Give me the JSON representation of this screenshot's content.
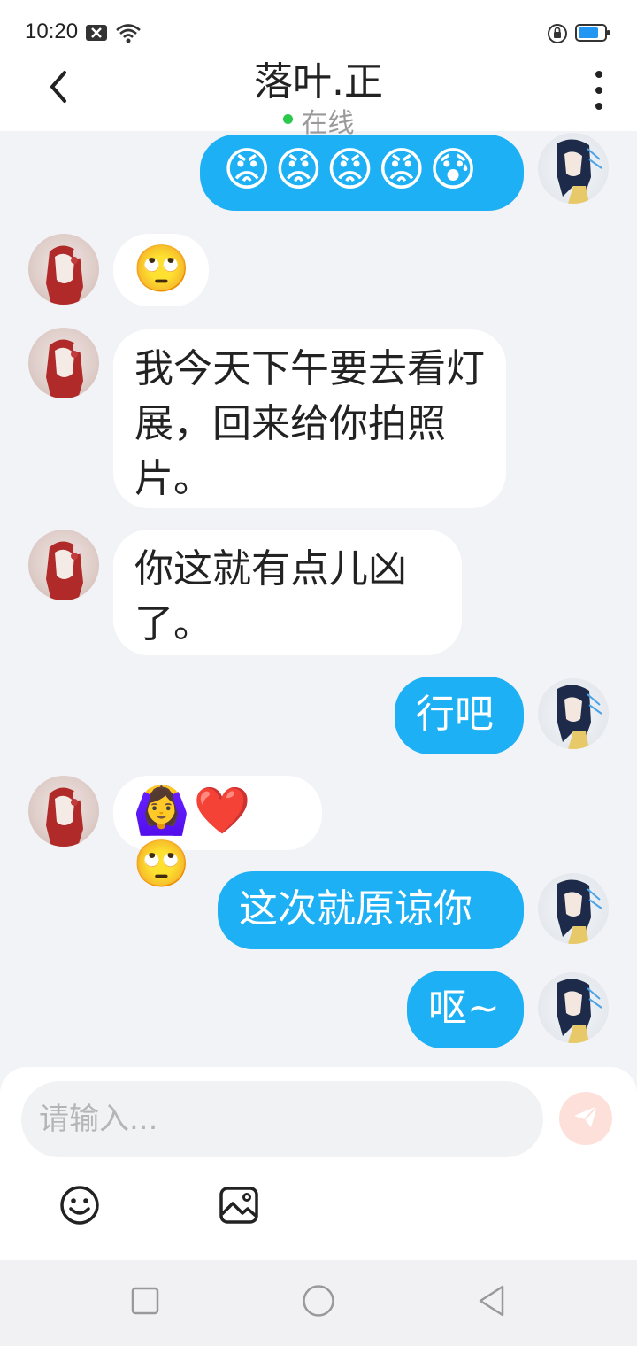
{
  "status_bar": {
    "time": "10:20",
    "icons": [
      "notification-x-icon",
      "wifi-icon",
      "lock-rotation-icon",
      "battery-icon"
    ],
    "battery_color": "#2196f3"
  },
  "header": {
    "title": "落叶.正",
    "status": "在线",
    "status_color": "#2bc84c",
    "back_icon": "chevron-left-icon",
    "more_icon": "more-vertical-icon"
  },
  "messages": [
    {
      "side": "right",
      "type": "emoji",
      "text": "😡😡😡😡😰"
    },
    {
      "side": "left",
      "type": "emoji",
      "text": "🙄"
    },
    {
      "side": "left",
      "type": "text",
      "text": "我今天下午要去看灯展，回来给你拍照片。"
    },
    {
      "side": "left",
      "type": "text",
      "text": "你这就有点儿凶了。"
    },
    {
      "side": "right",
      "type": "text",
      "text": "行吧"
    },
    {
      "side": "left",
      "type": "emoji",
      "text": "🙆‍♀️❤️🙄"
    },
    {
      "side": "right",
      "type": "text",
      "text": "这次就原谅你"
    },
    {
      "side": "right",
      "type": "text",
      "text": "呕~"
    }
  ],
  "input": {
    "placeholder": "请输入...",
    "value": ""
  },
  "toolbar": {
    "emoji_icon": "smiley-icon",
    "image_icon": "image-icon",
    "send_icon": "send-icon"
  },
  "nav": {
    "icons": [
      "recents-square-icon",
      "home-circle-icon",
      "back-triangle-icon"
    ]
  },
  "colors": {
    "accent_bubble": "#1eb0f4",
    "background": "#f2f3f7",
    "send_button_bg": "#fde0da"
  }
}
